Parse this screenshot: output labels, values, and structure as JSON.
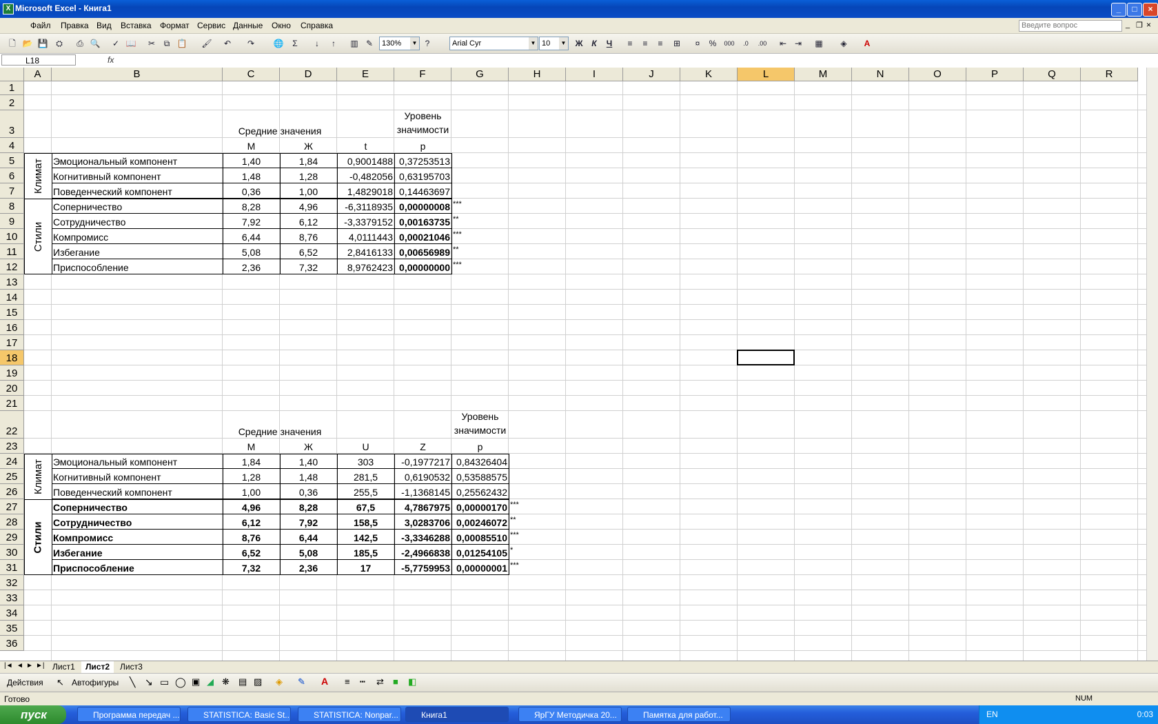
{
  "window": {
    "title": "Microsoft Excel - Книга1"
  },
  "menu": {
    "items": [
      "Файл",
      "Правка",
      "Вид",
      "Вставка",
      "Формат",
      "Сервис",
      "Данные",
      "Окно",
      "Справка"
    ],
    "ask_placeholder": "Введите вопрос"
  },
  "toolbar": {
    "zoom": "130%",
    "font": "Arial Cyr",
    "size": "10"
  },
  "formula": {
    "namebox": "L18",
    "fx": "fx"
  },
  "columns": [
    "A",
    "B",
    "C",
    "D",
    "E",
    "F",
    "G",
    "H",
    "I",
    "J",
    "K",
    "L",
    "M",
    "N",
    "O",
    "P",
    "Q",
    "R"
  ],
  "selected_column": "L",
  "selected_row": "18",
  "table1": {
    "header_means": "Средние значения",
    "header_sig": "Уровень значимости",
    "col_m": "М",
    "col_w": "Ж",
    "col_t": "t",
    "col_p": "p",
    "group1": "Климат",
    "group2": "Стили",
    "rows": [
      {
        "name": "Эмоциональный компонент",
        "m": "1,40",
        "w": "1,84",
        "t": "0,9001488",
        "p": "0,37253513",
        "star": ""
      },
      {
        "name": "Когнитивный компонент",
        "m": "1,48",
        "w": "1,28",
        "t": "-0,482056",
        "p": "0,63195703",
        "star": ""
      },
      {
        "name": "Поведенческий компонент",
        "m": "0,36",
        "w": "1,00",
        "t": "1,4829018",
        "p": "0,14463697",
        "star": ""
      },
      {
        "name": "Соперничество",
        "m": "8,28",
        "w": "4,96",
        "t": "-6,3118935",
        "p": "0,00000008",
        "star": "***"
      },
      {
        "name": "Сотрудничество",
        "m": "7,92",
        "w": "6,12",
        "t": "-3,3379152",
        "p": "0,00163735",
        "star": "**"
      },
      {
        "name": "Компромисс",
        "m": "6,44",
        "w": "8,76",
        "t": "4,0111443",
        "p": "0,00021046",
        "star": "***"
      },
      {
        "name": "Избегание",
        "m": "5,08",
        "w": "6,52",
        "t": "2,8416133",
        "p": "0,00656989",
        "star": "**"
      },
      {
        "name": "Приспособление",
        "m": "2,36",
        "w": "7,32",
        "t": "8,9762423",
        "p": "0,00000000",
        "star": "***"
      }
    ]
  },
  "table2": {
    "header_means": "Средние значения",
    "header_sig": "Уровень значимости",
    "col_m": "М",
    "col_w": "Ж",
    "col_u": "U",
    "col_z": "Z",
    "col_p": "p",
    "group1": "Климат",
    "group2": "Стили",
    "rows": [
      {
        "name": "Эмоциональный компонент",
        "m": "1,84",
        "w": "1,40",
        "u": "303",
        "z": "-0,1977217",
        "p": "0,84326404",
        "star": ""
      },
      {
        "name": "Когнитивный компонент",
        "m": "1,28",
        "w": "1,48",
        "u": "281,5",
        "z": "0,6190532",
        "p": "0,53588575",
        "star": ""
      },
      {
        "name": "Поведенческий компонент",
        "m": "1,00",
        "w": "0,36",
        "u": "255,5",
        "z": "-1,1368145",
        "p": "0,25562432",
        "star": ""
      },
      {
        "name": "Соперничество",
        "m": "4,96",
        "w": "8,28",
        "u": "67,5",
        "z": "4,7867975",
        "p": "0,00000170",
        "star": "***"
      },
      {
        "name": "Сотрудничество",
        "m": "6,12",
        "w": "7,92",
        "u": "158,5",
        "z": "3,0283706",
        "p": "0,00246072",
        "star": "**"
      },
      {
        "name": "Компромисс",
        "m": "8,76",
        "w": "6,44",
        "u": "142,5",
        "z": "-3,3346288",
        "p": "0,00085510",
        "star": "***"
      },
      {
        "name": "Избегание",
        "m": "6,52",
        "w": "5,08",
        "u": "185,5",
        "z": "-2,4966838",
        "p": "0,01254105",
        "star": "*"
      },
      {
        "name": "Приспособление",
        "m": "7,32",
        "w": "2,36",
        "u": "17",
        "z": "-5,7759953",
        "p": "0,00000001",
        "star": "***"
      }
    ]
  },
  "sheets": [
    "Лист1",
    "Лист2",
    "Лист3"
  ],
  "active_sheet": "Лист2",
  "drawing": {
    "actions": "Действия",
    "autoshapes": "Автофигуры"
  },
  "status": {
    "ready": "Готово",
    "num": "NUM"
  },
  "taskbar": {
    "start": "пуск",
    "tasks": [
      "Программа передач ...",
      "STATISTICA: Basic St...",
      "STATISTICA: Nonpar...",
      "Книга1",
      "ЯрГУ Методичка 20...",
      "Памятка для работ..."
    ],
    "active_task": "Книга1",
    "lang": "EN",
    "clock": "0:03"
  }
}
